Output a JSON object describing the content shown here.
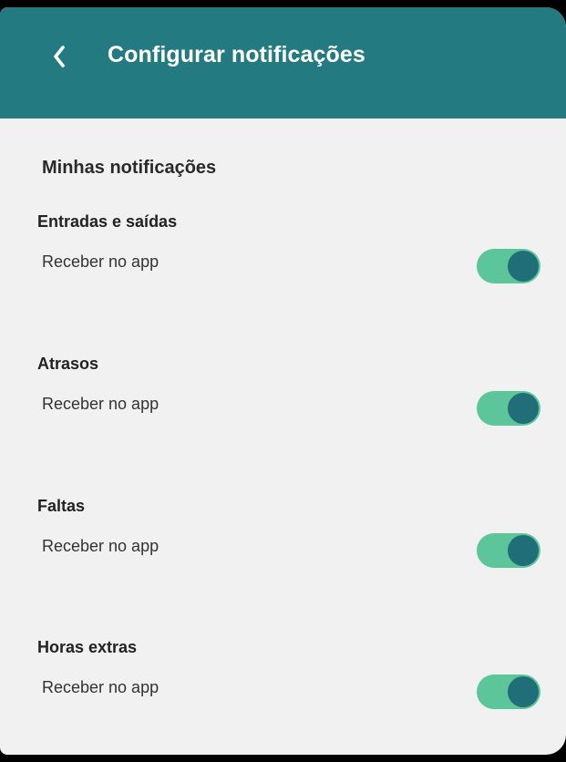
{
  "header": {
    "title": "Configurar notificações",
    "back_icon": "chevron-left-icon",
    "background_color": "#237a80"
  },
  "section": {
    "title": "Minhas notificações"
  },
  "settings": [
    {
      "title": "Entradas e saídas",
      "label": "Receber no app",
      "enabled": true
    },
    {
      "title": "Atrasos",
      "label": "Receber no app",
      "enabled": true
    },
    {
      "title": "Faltas",
      "label": "Receber no app",
      "enabled": true
    },
    {
      "title": "Horas extras",
      "label": "Receber no app",
      "enabled": true
    }
  ],
  "colors": {
    "toggle_track_on": "#5cc59a",
    "toggle_knob_on": "#1f6e78",
    "page_background": "#f1f1f1"
  }
}
